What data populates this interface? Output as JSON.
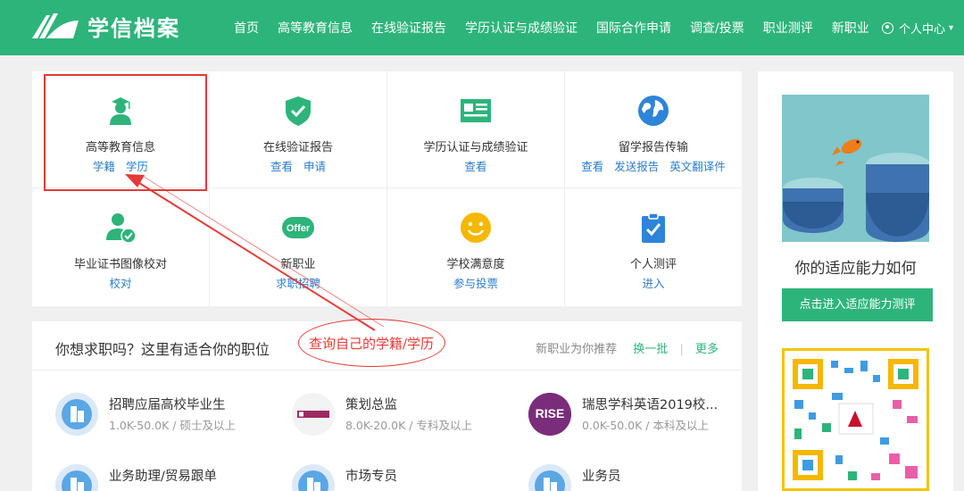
{
  "brand": {
    "name": "学信档案"
  },
  "nav": {
    "items": [
      "首页",
      "高等教育信息",
      "在线验证报告",
      "学历认证与成绩验证",
      "国际合作申请",
      "调查/投票",
      "职业测评",
      "新职业"
    ],
    "user_center": "个人中心"
  },
  "services": [
    {
      "title": "高等教育信息",
      "links": [
        "学籍",
        "学历"
      ],
      "icon": "graduate-icon"
    },
    {
      "title": "在线验证报告",
      "links": [
        "查看",
        "申请"
      ],
      "icon": "shield-check-icon"
    },
    {
      "title": "学历认证与成绩验证",
      "links": [
        "查看"
      ],
      "icon": "certificate-card-icon"
    },
    {
      "title": "留学报告传输",
      "links": [
        "查看",
        "发送报告",
        "英文翻译件"
      ],
      "icon": "globe-icon"
    },
    {
      "title": "毕业证书图像校对",
      "links": [
        "校对"
      ],
      "icon": "user-check-icon"
    },
    {
      "title": "新职业",
      "links": [
        "求职招聘"
      ],
      "icon": "offer-icon",
      "icon_text": "Offer"
    },
    {
      "title": "学校满意度",
      "links": [
        "参与投票"
      ],
      "icon": "smiley-icon"
    },
    {
      "title": "个人测评",
      "links": [
        "进入"
      ],
      "icon": "clipboard-check-icon"
    }
  ],
  "jobs_panel": {
    "title": "你想求职吗？这里有适合你的职位",
    "recommend_text": "新职业为你推荐",
    "refresh_label": "换一批",
    "separator": "|",
    "more_label": "更多",
    "jobs": [
      {
        "title": "招聘应届高校毕业生",
        "salary": "1.0K-50.0K",
        "requirement": "硕士及以上",
        "logo": "building-icon"
      },
      {
        "title": "策划总监",
        "salary": "8.0K-20.0K",
        "requirement": "专科及以上",
        "logo": "company-logo"
      },
      {
        "title": "瑞思学科英语2019校...",
        "salary": "0.0K-50.0K",
        "requirement": "本科及以上",
        "logo": "rise-logo",
        "logo_text": "RISE"
      },
      {
        "title": "业务助理/贸易跟单",
        "salary": "",
        "requirement": "",
        "logo": "building-icon"
      },
      {
        "title": "市场专员",
        "salary": "",
        "requirement": "",
        "logo": "building-icon"
      },
      {
        "title": "业务员",
        "salary": "",
        "requirement": "",
        "logo": "building-icon"
      }
    ],
    "meta_separator": " / "
  },
  "sidebar": {
    "title": "你的适应能力如何",
    "button_label": "点击进入适应能力测评"
  },
  "annotation": {
    "text": "查询自己的学籍/学历",
    "color": "#e53935"
  },
  "colors": {
    "brand_green": "#2db47b",
    "link_blue": "#2c7cc9"
  }
}
